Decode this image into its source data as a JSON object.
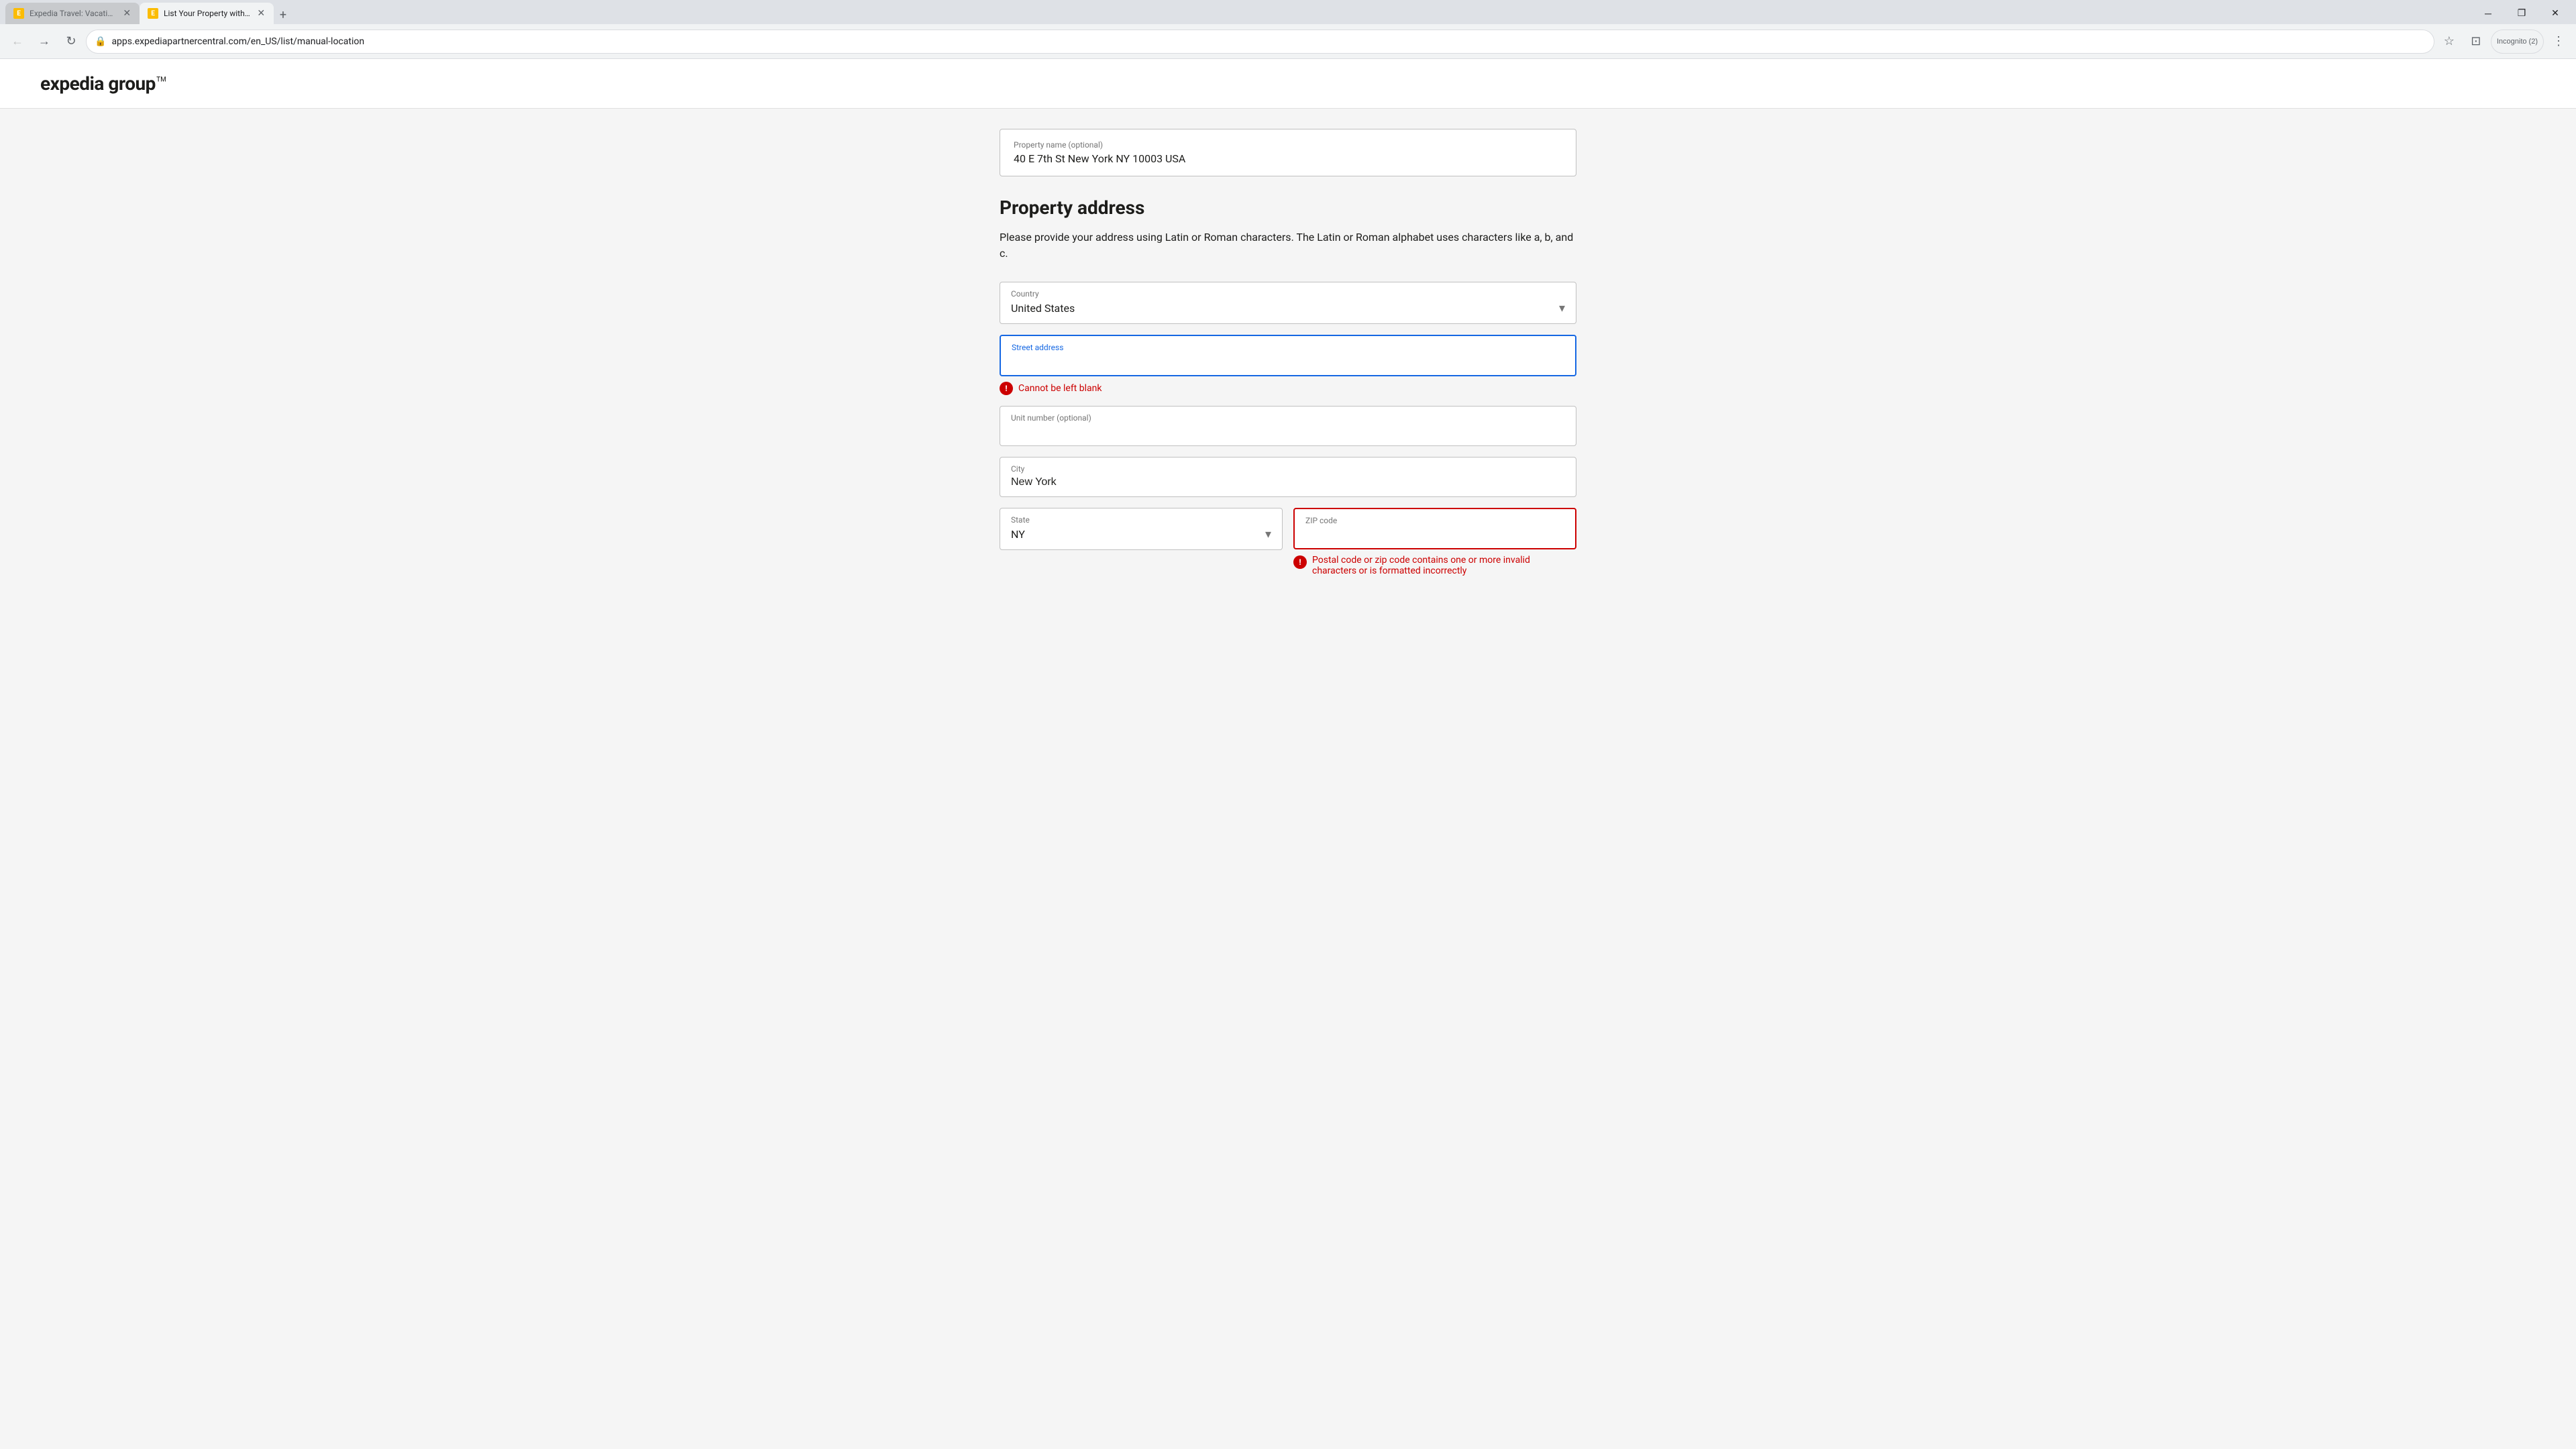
{
  "browser": {
    "tabs": [
      {
        "id": "tab-1",
        "title": "Expedia Travel: Vacation Home...",
        "active": false,
        "icon": "E"
      },
      {
        "id": "tab-2",
        "title": "List Your Property with Expedia...",
        "active": true,
        "icon": "E"
      }
    ],
    "new_tab_label": "+",
    "window_controls": {
      "minimize": "─",
      "maximize": "❐",
      "close": "✕"
    },
    "nav": {
      "back": "←",
      "forward": "→",
      "reload": "↻",
      "url": "apps.expediapartnercentral.com/en_US/list/manual-location",
      "bookmark": "☆",
      "profile_icon": "⊡",
      "incognito_label": "Incognito (2)",
      "menu": "⋮"
    }
  },
  "header": {
    "logo_text_light": "expedia ",
    "logo_text_bold": "group"
  },
  "form": {
    "property_name_label": "Property name (optional)",
    "property_name_value": "40 E 7th St New York NY 10003 USA",
    "section_title": "Property address",
    "section_description": "Please provide your address using Latin or Roman characters. The Latin or Roman alphabet uses characters like a, b, and c.",
    "country_label": "Country",
    "country_value": "United States",
    "street_address_label": "Street address",
    "street_address_error": "Cannot be left blank",
    "unit_number_label": "Unit number (optional)",
    "city_label": "City",
    "city_value": "New York",
    "state_label": "State",
    "state_value": "NY",
    "zip_label": "ZIP code",
    "zip_error": "Postal code or zip code contains one or more invalid characters or is formatted incorrectly"
  }
}
